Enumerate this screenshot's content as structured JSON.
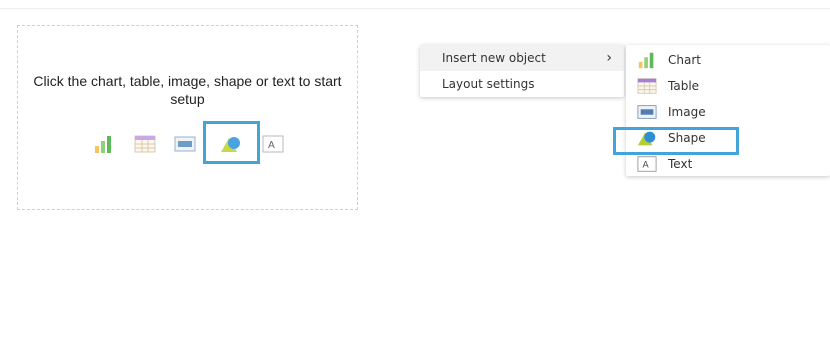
{
  "placeholder": {
    "text": "Click the chart, table, image, shape or text to start setup",
    "icons": [
      "chart-icon",
      "table-icon",
      "image-icon",
      "shape-icon",
      "text-icon"
    ],
    "highlighted": "shape-icon"
  },
  "context_menu": {
    "items": [
      {
        "label": "Insert new object",
        "has_submenu": true,
        "arrow": "›"
      },
      {
        "label": "Layout settings",
        "has_submenu": false
      }
    ]
  },
  "submenu": {
    "items": [
      {
        "label": "Chart",
        "icon": "chart-icon"
      },
      {
        "label": "Table",
        "icon": "table-icon"
      },
      {
        "label": "Image",
        "icon": "image-icon"
      },
      {
        "label": "Shape",
        "icon": "shape-icon"
      },
      {
        "label": "Text",
        "icon": "text-icon"
      }
    ],
    "highlighted": "Shape"
  },
  "colors": {
    "highlight": "#45a3dc",
    "menu_active": "#f2f2f2"
  }
}
